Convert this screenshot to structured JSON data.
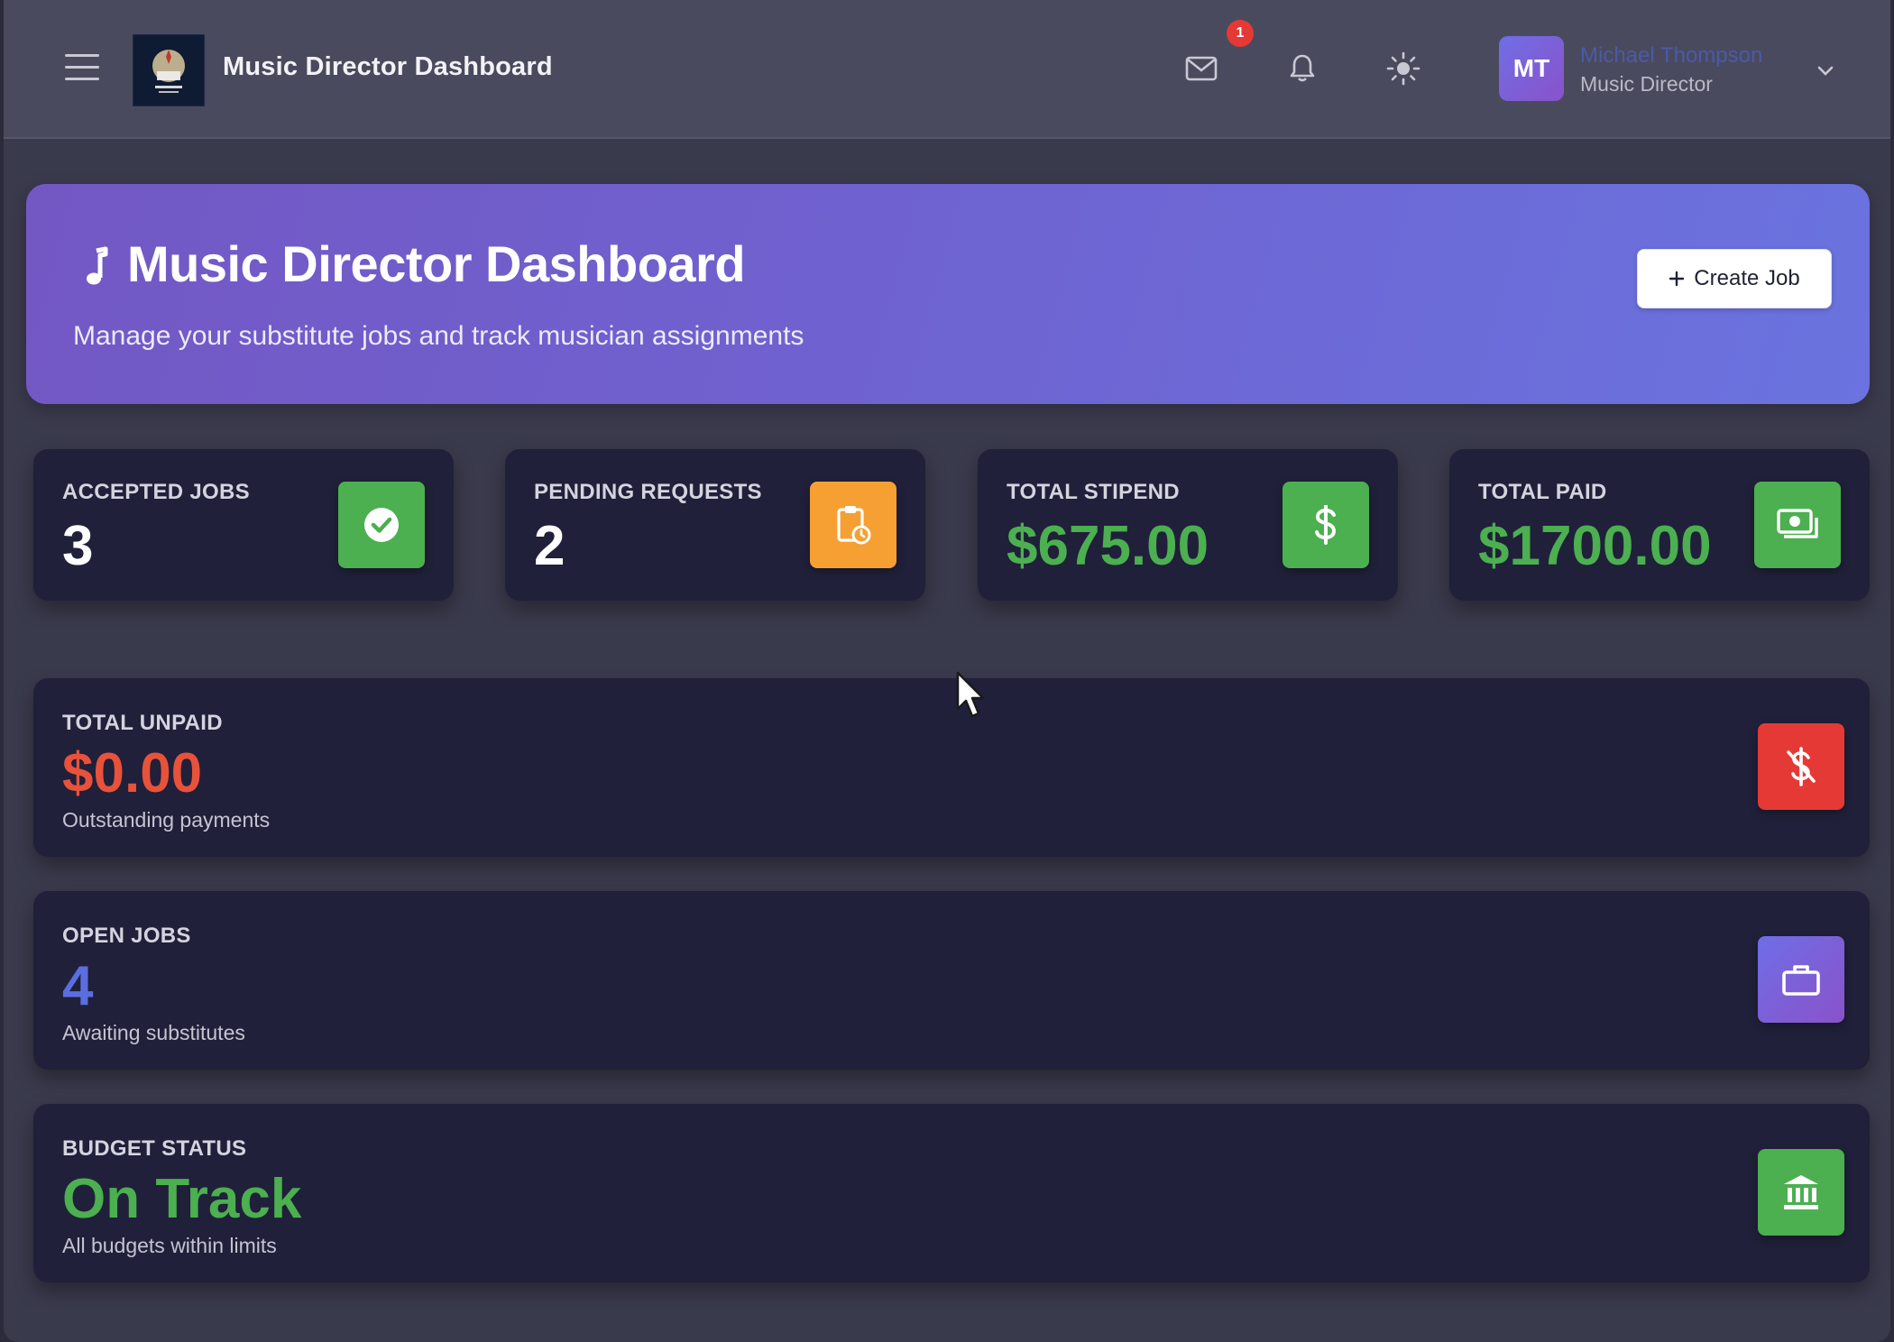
{
  "header": {
    "title": "Music Director Dashboard",
    "mail_badge": "1",
    "user": {
      "initials": "MT",
      "name": "Michael Thompson",
      "role": "Music Director"
    },
    "icons": [
      "menu-icon",
      "mail-icon",
      "bell-icon",
      "sun-icon",
      "chevron-down-icon"
    ]
  },
  "hero": {
    "title": "Music Director Dashboard",
    "subtitle": "Manage your substitute jobs and track musician assignments",
    "create_button": "Create Job"
  },
  "stats": [
    {
      "label": "ACCEPTED JOBS",
      "value": "3",
      "icon": "check-circle-icon",
      "icon_color": "#4caf50",
      "value_color": "#ffffff"
    },
    {
      "label": "PENDING REQUESTS",
      "value": "2",
      "icon": "clipboard-clock-icon",
      "icon_color": "#f6a033",
      "value_color": "#ffffff"
    },
    {
      "label": "TOTAL STIPEND",
      "value": "$675.00",
      "icon": "dollar-icon",
      "icon_color": "#4caf50",
      "value_color": "#4caf50"
    },
    {
      "label": "TOTAL PAID",
      "value": "$1700.00",
      "icon": "money-bill-icon",
      "icon_color": "#4caf50",
      "value_color": "#4caf50"
    }
  ],
  "summaries": [
    {
      "label": "TOTAL UNPAID",
      "value": "$0.00",
      "sub": "Outstanding payments",
      "icon": "no-dollar-icon",
      "icon_color": "#e53935",
      "value_color": "#e8523a"
    },
    {
      "label": "OPEN JOBS",
      "value": "4",
      "sub": "Awaiting substitutes",
      "icon": "briefcase-icon",
      "icon_color": "#7a5fd8",
      "value_color": "#5b6ee1"
    },
    {
      "label": "BUDGET STATUS",
      "value": "On Track",
      "sub": "All budgets within limits",
      "icon": "bank-icon",
      "icon_color": "#4caf50",
      "value_color": "#4caf50"
    }
  ]
}
